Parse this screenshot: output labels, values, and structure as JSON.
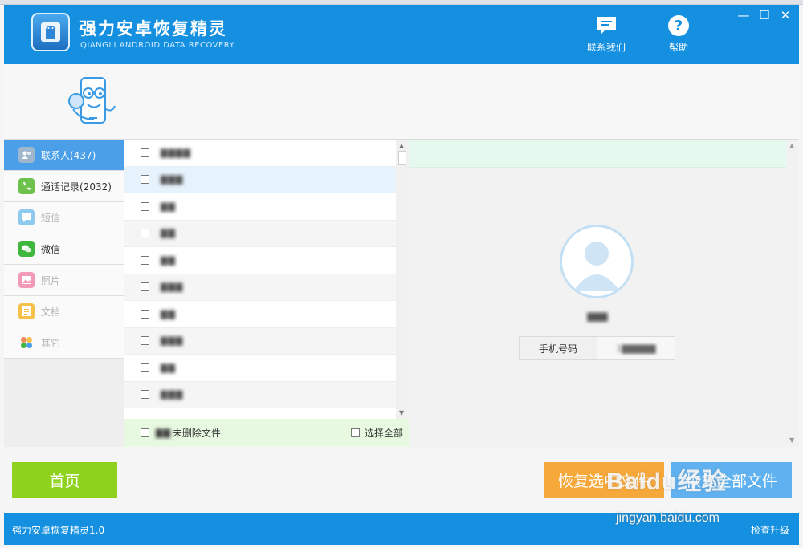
{
  "header": {
    "title": "强力安卓恢复精灵",
    "subtitle": "QIANGLI ANDROID DATA RECOVERY",
    "contact_label": "联系我们",
    "help_label": "帮助",
    "window_controls": {
      "minimize": "—",
      "maximize": "☐",
      "close": "✕"
    }
  },
  "nav": {
    "items": [
      {
        "label": "联系人(437)",
        "icon": "contacts-icon",
        "state": "active",
        "color": "#9fb7cc"
      },
      {
        "label": "通话记录(2032)",
        "icon": "phone-icon",
        "state": "normal",
        "color": "#6cc24a"
      },
      {
        "label": "短信",
        "icon": "sms-icon",
        "state": "disabled",
        "color": "#8ec9ef"
      },
      {
        "label": "微信",
        "icon": "wechat-icon",
        "state": "normal",
        "color": "#3fb73f"
      },
      {
        "label": "照片",
        "icon": "photo-icon",
        "state": "disabled",
        "color": "#f39ab8"
      },
      {
        "label": "文档",
        "icon": "document-icon",
        "state": "disabled",
        "color": "#f5c14b"
      },
      {
        "label": "其它",
        "icon": "other-icon",
        "state": "disabled",
        "color": "#f08a5d"
      }
    ]
  },
  "contacts": {
    "rows": [
      {
        "name": "▇▇▇▇"
      },
      {
        "name": "▇▇▇"
      },
      {
        "name": "▇▇"
      },
      {
        "name": "▇▇"
      },
      {
        "name": "▇▇"
      },
      {
        "name": "▇▇▇"
      },
      {
        "name": "▇▇"
      },
      {
        "name": "▇▇▇"
      },
      {
        "name": "▇▇"
      },
      {
        "name": "▇▇▇"
      }
    ],
    "selected_index": 1,
    "footer": {
      "undeleted_prefix": "▇▇",
      "undeleted_label": "未删除文件",
      "select_all_label": "选择全部"
    }
  },
  "detail": {
    "name": "▇▇▇",
    "phone_label": "手机号码",
    "phone_value": "1▇▇▇▇▇"
  },
  "buttons": {
    "home": "首页",
    "recover_selected": "恢复选中文件",
    "recover_all": "恢复全部文件"
  },
  "status": {
    "version": "强力安卓恢复精灵1.0",
    "check_update": "检查升级"
  },
  "watermark": {
    "logo": "Baidu经验",
    "url": "jingyan.baidu.com"
  },
  "colors": {
    "brand_blue": "#1590e0",
    "home_green": "#8fd21e",
    "recover_orange": "#f7a83a",
    "recover_all_blue": "#5fb1ef",
    "active_nav": "#4a9fe8"
  }
}
